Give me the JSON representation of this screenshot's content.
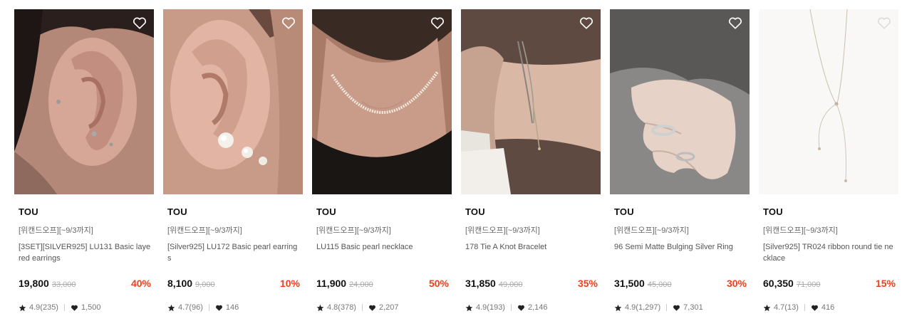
{
  "products": [
    {
      "brand": "TOU",
      "promo": "[위캔드오프][~9/3까지]",
      "title": "[3SET][SILVER925] LU131 Basic layered earrings",
      "price": "19,800",
      "original_price": "33,000",
      "discount": "40%",
      "rating": "4.9(235)",
      "likes": "1,500",
      "wishlist_icon": "heart-outline-icon",
      "image": "ear-stud-earrings-photo"
    },
    {
      "brand": "TOU",
      "promo": "[위캔드오프][~9/3까지]",
      "title": "[Silver925] LU172 Basic pearl earrings",
      "price": "8,100",
      "original_price": "9,000",
      "discount": "10%",
      "rating": "4.7(96)",
      "likes": "146",
      "wishlist_icon": "heart-outline-icon",
      "image": "ear-pearl-earrings-photo"
    },
    {
      "brand": "TOU",
      "promo": "[위캔드오프][~9/3까지]",
      "title": "LU115 Basic pearl necklace",
      "price": "11,900",
      "original_price": "24,000",
      "discount": "50%",
      "rating": "4.8(378)",
      "likes": "2,207",
      "wishlist_icon": "heart-outline-icon",
      "image": "neck-pearl-necklace-photo"
    },
    {
      "brand": "TOU",
      "promo": "[위캔드오프][~9/3까지]",
      "title": "178 Tie A Knot Bracelet",
      "price": "31,850",
      "original_price": "49,000",
      "discount": "35%",
      "rating": "4.9(193)",
      "likes": "2,146",
      "wishlist_icon": "heart-outline-icon",
      "image": "wrist-bracelet-photo"
    },
    {
      "brand": "TOU",
      "promo": "[위캔드오프][~9/3까지]",
      "title": "96 Semi Matte Bulging Silver Ring",
      "price": "31,500",
      "original_price": "45,000",
      "discount": "30%",
      "rating": "4.9(1,297)",
      "likes": "7,301",
      "wishlist_icon": "heart-outline-icon",
      "image": "hand-ring-photo"
    },
    {
      "brand": "TOU",
      "promo": "[위캔드오프][~9/3까지]",
      "title": "[Silver925] TR024 ribbon round tie necklace",
      "price": "60,350",
      "original_price": "71,000",
      "discount": "15%",
      "rating": "4.7(13)",
      "likes": "416",
      "wishlist_icon": "heart-outline-icon",
      "image": "ribbon-necklace-product-photo"
    }
  ],
  "colors": {
    "discount": "#f0401a",
    "brand_text": "#111111",
    "muted_text": "#777777"
  }
}
